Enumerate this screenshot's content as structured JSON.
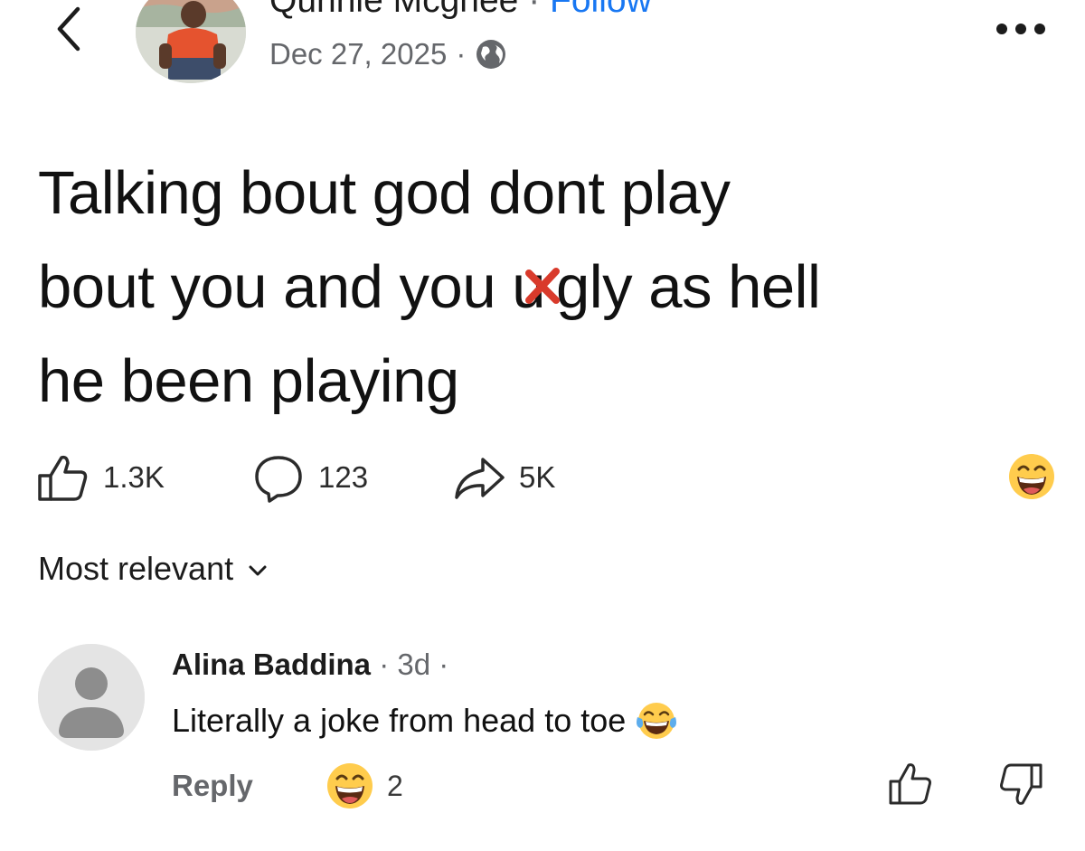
{
  "header": {
    "author": "Qunnie Mcghee",
    "separator": "·",
    "follow_label": "Follow",
    "date": "Dec 27, 2025",
    "date_separator": "·",
    "back_icon": "chevron-left-icon",
    "privacy_icon": "globe-icon",
    "more_icon": "more-horizontal-icon"
  },
  "post": {
    "line1": "Talking bout god dont play",
    "line2_before": "bout you and you u",
    "line2_after": "gly as hell",
    "line3": "he been playing",
    "overlay_icon": "red-x-mark"
  },
  "actions": {
    "likes": "1.3K",
    "comments": "123",
    "shares": "5K",
    "reaction_emoji": "grinning-face-emoji"
  },
  "sort": {
    "label": "Most relevant"
  },
  "comment": {
    "author": "Alina Baddina",
    "separator": "·",
    "time": "3d",
    "trailing_separator": "·",
    "text": "Literally a joke from head to toe",
    "text_emoji": "tears-of-joy-emoji",
    "reply_label": "Reply",
    "reaction_count": "2",
    "reaction_emoji": "grinning-face-emoji"
  },
  "colors": {
    "follow": "#1877f2",
    "secondary_text": "#65676b",
    "emoji_yellow": "#ffcc4d",
    "red_x": "#d93a2b"
  }
}
